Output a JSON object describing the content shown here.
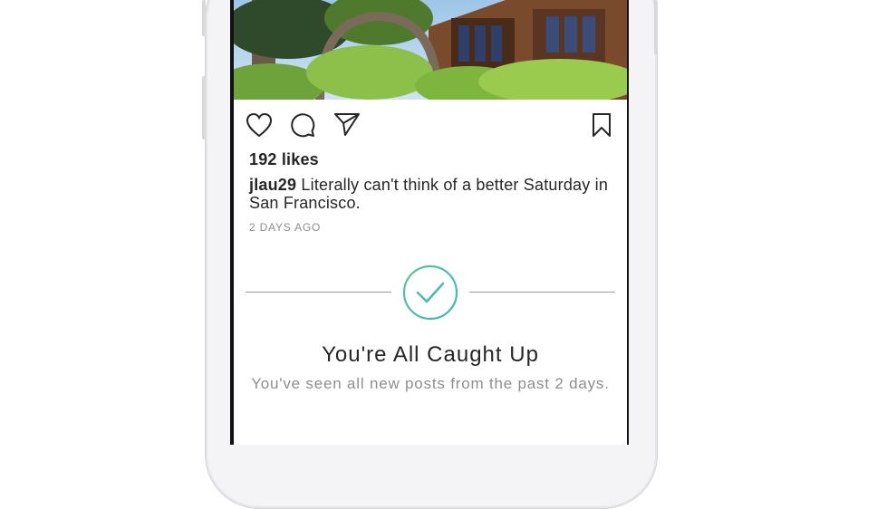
{
  "post": {
    "likes": "192 likes",
    "username": "jlau29",
    "caption": " Literally can't think of a better Saturday in San Francisco.",
    "timestamp": "2 DAYS AGO"
  },
  "icons": {
    "like": "heart-icon",
    "comment": "comment-icon",
    "share": "send-icon",
    "save": "bookmark-icon",
    "caught_up": "checkmark-circle-icon"
  },
  "caught_up": {
    "title": "You're All Caught Up",
    "subtitle": "You've seen all new posts from the past 2 days."
  },
  "colors": {
    "text": "#262626",
    "muted": "#8e8e8e",
    "check_gradient_start": "#5fc58f",
    "check_gradient_end": "#3cb4c4"
  }
}
